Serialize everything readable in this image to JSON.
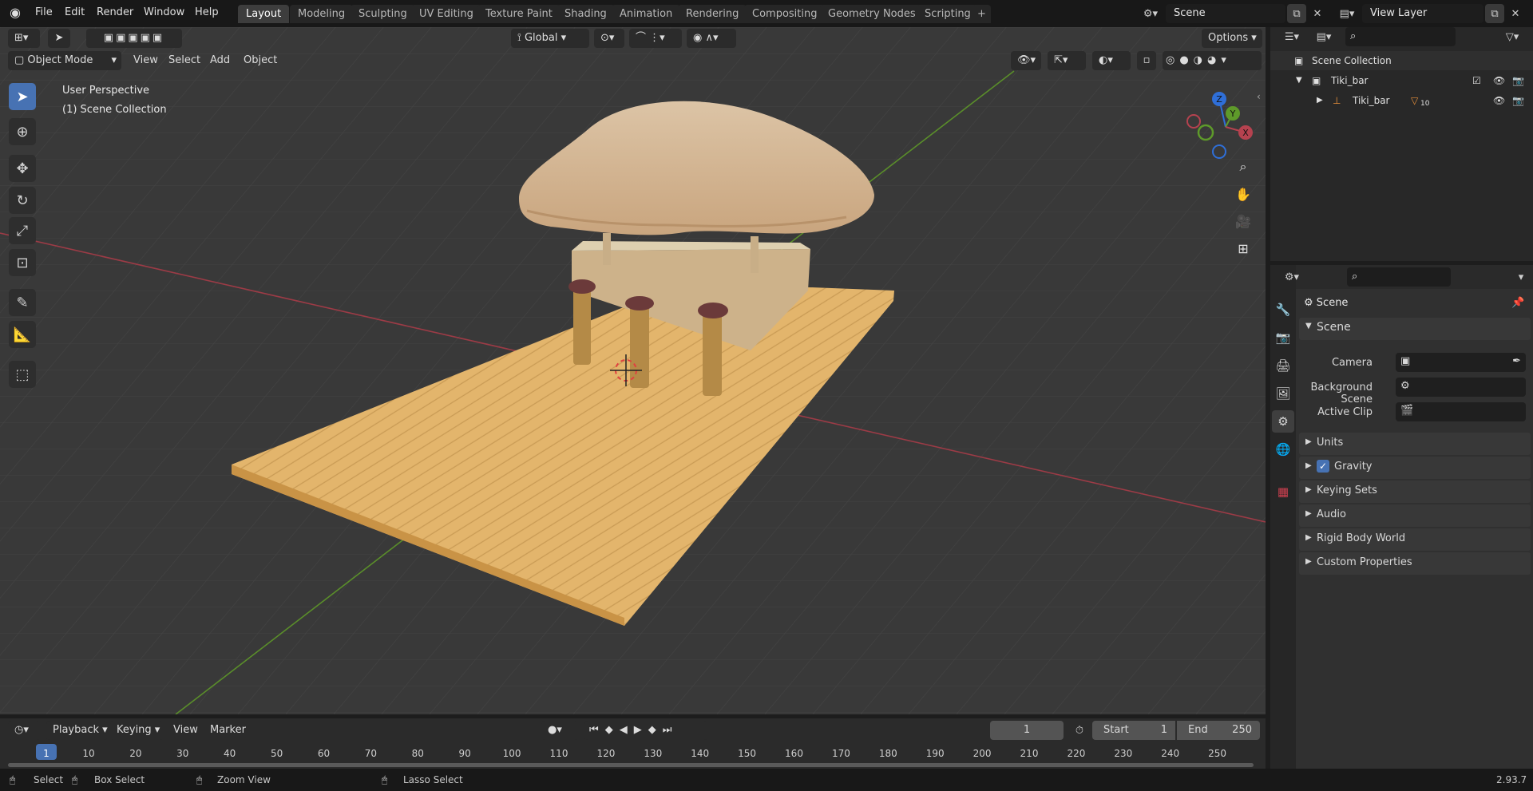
{
  "menu": [
    "File",
    "Edit",
    "Render",
    "Window",
    "Help"
  ],
  "workspaces": [
    "Layout",
    "Modeling",
    "Sculpting",
    "UV Editing",
    "Texture Paint",
    "Shading",
    "Animation",
    "Rendering",
    "Compositing",
    "Geometry Nodes",
    "Scripting"
  ],
  "active_workspace": "Layout",
  "scene_name": "Scene",
  "view_layer": "View Layer",
  "viewport": {
    "mode": "Object Mode",
    "menus": [
      "View",
      "Select",
      "Add",
      "Object"
    ],
    "transform_orientation": "Global",
    "options_label": "Options",
    "perspective_label": "User Perspective",
    "collection_label": "(1) Scene Collection",
    "gizmo_axes": [
      "Z",
      "Y",
      "X"
    ]
  },
  "outliner": {
    "root": "Scene Collection",
    "collection": "Tiki_bar",
    "object": "Tiki_bar",
    "object_badge": "10"
  },
  "properties": {
    "context_label": "Scene",
    "panel_title": "Scene",
    "fields": [
      "Camera",
      "Background Scene",
      "Active Clip"
    ],
    "subpanels": [
      "Units",
      "Gravity",
      "Keying Sets",
      "Audio",
      "Rigid Body World",
      "Custom Properties"
    ],
    "gravity_checked": true
  },
  "timeline": {
    "menus": [
      "Playback",
      "Keying",
      "View",
      "Marker"
    ],
    "current_frame": "1",
    "start_label": "Start",
    "start_value": "1",
    "end_label": "End",
    "end_value": "250",
    "ticks": [
      "1",
      "10",
      "20",
      "30",
      "40",
      "50",
      "60",
      "70",
      "80",
      "90",
      "100",
      "110",
      "120",
      "130",
      "140",
      "150",
      "160",
      "170",
      "180",
      "190",
      "200",
      "210",
      "220",
      "230",
      "240",
      "250"
    ]
  },
  "statusbar": {
    "select": "Select",
    "box_select": "Box Select",
    "zoom_view": "Zoom View",
    "lasso_select": "Lasso Select",
    "version": "2.93.7"
  },
  "colors": {
    "accent": "#4772b3",
    "x_axis": "#b5424f",
    "y_axis": "#5e9a2a",
    "z_axis": "#2f6fd8",
    "viewport_bg": "#393939"
  }
}
